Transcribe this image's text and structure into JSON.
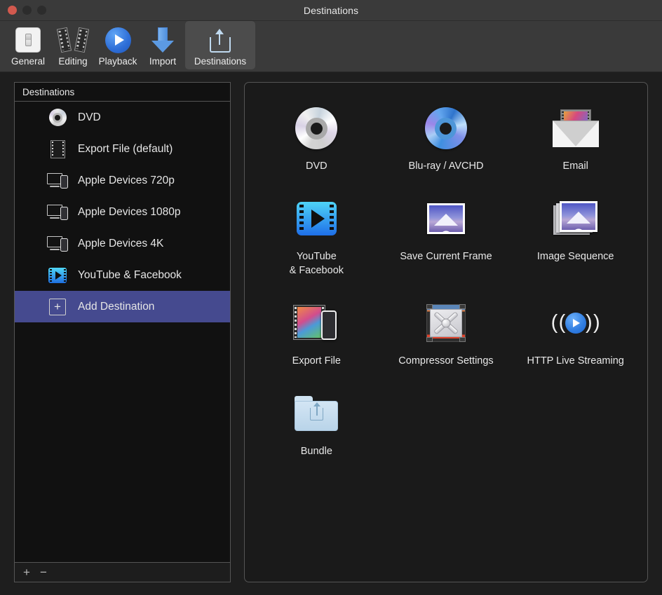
{
  "window": {
    "title": "Destinations",
    "traffic_lights": [
      "close-button",
      "minimize-button",
      "maximize-button"
    ]
  },
  "toolbar": {
    "items": [
      {
        "label": "General",
        "icon": "general-toggle-icon",
        "selected": false
      },
      {
        "label": "Editing",
        "icon": "film-strips-icon",
        "selected": false
      },
      {
        "label": "Playback",
        "icon": "play-circle-icon",
        "selected": false
      },
      {
        "label": "Import",
        "icon": "down-arrow-icon",
        "selected": false
      },
      {
        "label": "Destinations",
        "icon": "share-up-icon",
        "selected": true
      }
    ]
  },
  "sidebar": {
    "header": "Destinations",
    "items": [
      {
        "label": "DVD",
        "icon": "disc-icon",
        "selected": false
      },
      {
        "label": "Export File (default)",
        "icon": "film-color-icon",
        "selected": false
      },
      {
        "label": "Apple Devices 720p",
        "icon": "monitor-phone-icon",
        "selected": false
      },
      {
        "label": "Apple Devices 1080p",
        "icon": "monitor-phone-icon",
        "selected": false
      },
      {
        "label": "Apple Devices 4K",
        "icon": "monitor-phone-icon",
        "selected": false
      },
      {
        "label": "YouTube & Facebook",
        "icon": "video-play-icon",
        "selected": false
      },
      {
        "label": "Add Destination",
        "icon": "plus-square-icon",
        "selected": true
      }
    ],
    "footer": {
      "add": "+",
      "remove": "−"
    }
  },
  "destinations": {
    "items": [
      {
        "label": "DVD",
        "icon": "dvd-disc-icon"
      },
      {
        "label": "Blu-ray / AVCHD",
        "icon": "bluray-disc-icon"
      },
      {
        "label": "Email",
        "icon": "envelope-film-icon"
      },
      {
        "label": "YouTube\n& Facebook",
        "icon": "video-play-icon"
      },
      {
        "label": "Save Current Frame",
        "icon": "photo-icon"
      },
      {
        "label": "Image Sequence",
        "icon": "photo-stack-icon"
      },
      {
        "label": "Export File",
        "icon": "film-phone-icon"
      },
      {
        "label": "Compressor Settings",
        "icon": "compressor-x-icon"
      },
      {
        "label": "HTTP Live Streaming",
        "icon": "broadcast-play-icon"
      },
      {
        "label": "Bundle",
        "icon": "folder-share-icon"
      }
    ]
  },
  "colors": {
    "window_chrome": "#3a3a3a",
    "content_bg": "#1e1e1e",
    "panel_bg": "#1a1a1a",
    "list_bg": "#111111",
    "selection": "#454a8f",
    "border": "#555555",
    "text": "#e8e8e8",
    "close_button": "#d2594e"
  }
}
